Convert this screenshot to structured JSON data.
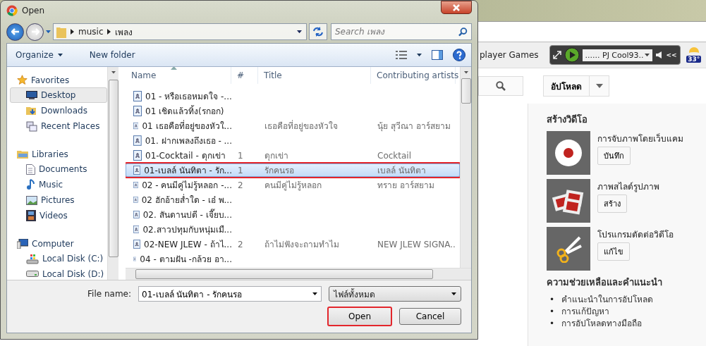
{
  "dialog": {
    "title": "Open",
    "breadcrumb": [
      "music",
      "เพลง"
    ],
    "search": {
      "placeholder": "Search เพลง"
    },
    "toolbar": {
      "organize": "Organize",
      "new_folder": "New folder"
    },
    "nav": [
      {
        "label": "Favorites",
        "children": [
          {
            "label": "Desktop",
            "selected": true
          },
          {
            "label": "Downloads",
            "selected": false
          },
          {
            "label": "Recent Places",
            "selected": false
          }
        ]
      },
      {
        "label": "Libraries",
        "children": [
          {
            "label": "Documents",
            "selected": false
          },
          {
            "label": "Music",
            "selected": false
          },
          {
            "label": "Pictures",
            "selected": false
          },
          {
            "label": "Videos",
            "selected": false
          }
        ]
      },
      {
        "label": "Computer",
        "children": [
          {
            "label": "Local Disk (C:)",
            "selected": false
          },
          {
            "label": "Local Disk (D:)",
            "selected": false
          }
        ]
      }
    ],
    "columns": [
      "Name",
      "#",
      "Title",
      "Contributing artists"
    ],
    "rows": [
      {
        "name": "01 - หรือเธอหมดใจ -...",
        "selected": false,
        "highlighted": false
      },
      {
        "name": "01 เชิดแล้วทิ้ง(รกอก)",
        "selected": false,
        "highlighted": false
      },
      {
        "name": "01 เธอคือที่อยู่ของหัวใ...",
        "title": "เธอคือที่อยู่ของหัวใจ",
        "artist": "นุ้ย สุวีณา อาร์สยาม",
        "selected": false,
        "highlighted": false
      },
      {
        "name": "01. ฝากเพลงถึงเธอ - ...",
        "selected": false,
        "highlighted": false
      },
      {
        "name": "01-Cocktail - ดุกเข่า",
        "number": "1",
        "title": "ดุกเข่า",
        "artist": "Cocktail",
        "selected": false,
        "highlighted": false
      },
      {
        "name": "01-เบลล์ นันทิตา - รัก...",
        "number": "1",
        "title": "รักคนรอ",
        "artist": "เบลล์ นันทิตา",
        "selected": true,
        "highlighted": true
      },
      {
        "name": "02 - คนมีคู่ไม่รู้หลอก -...",
        "number": "2",
        "title": "คนมีคู่ไม่รู้หลอก",
        "artist": "ทราย อาร์สยาม",
        "selected": false,
        "highlighted": false
      },
      {
        "name": "02 ฮักอ้ายส่ำใด - เอ๋ พ...",
        "selected": false,
        "highlighted": false
      },
      {
        "name": "02. สันดานบ่ดี - เจี๊ยบ...",
        "selected": false,
        "highlighted": false
      },
      {
        "name": "02.สาวปทุมกับหนุ่มเมื...",
        "selected": false,
        "highlighted": false
      },
      {
        "name": "02-NEW JLEW - ถ้าไ...",
        "number": "2",
        "title": "ถ้าไม่ฟังจะถามทำไม",
        "artist": "NEW JLEW SIGNA...",
        "selected": false,
        "highlighted": false
      },
      {
        "name": "04 - ตามฝัน -กล้วย อา...",
        "selected": false,
        "highlighted": false
      }
    ],
    "file_name": {
      "label": "File name:",
      "value": "01-เบลล์ นันทิตา - รักคนรอ"
    },
    "file_type": "ไฟล์ทั้งหมด",
    "buttons": [
      {
        "label": "Open",
        "highlighted": true
      },
      {
        "label": "Cancel",
        "highlighted": false
      }
    ]
  },
  "page": {
    "games_menu": "player Games",
    "player": {
      "station": "...... PJ Cool93..",
      "back": "<<"
    },
    "weather": "33°",
    "upload": "อัปโหลด",
    "create_heading": "สร้างวิดีโอ",
    "create_items": [
      {
        "title": "การจับภาพโดยเว็บแคม",
        "action": "บันทึก"
      },
      {
        "title": "ภาพสไลด์รูปภาพ",
        "action": "สร้าง"
      },
      {
        "title": "โปรแกรมตัดต่อวิดีโอ",
        "action": "แก้ไข"
      }
    ],
    "help_heading": "ความช่วยเหลือและคำแนะนำ",
    "help_links": [
      {
        "bullet": "•",
        "text": "คำแนะนำในการอัปโหลด"
      },
      {
        "bullet": "•",
        "text": "การแก้ปัญหา"
      },
      {
        "bullet": "•",
        "text": "การอัปโหลดทางมือถือ"
      }
    ]
  }
}
